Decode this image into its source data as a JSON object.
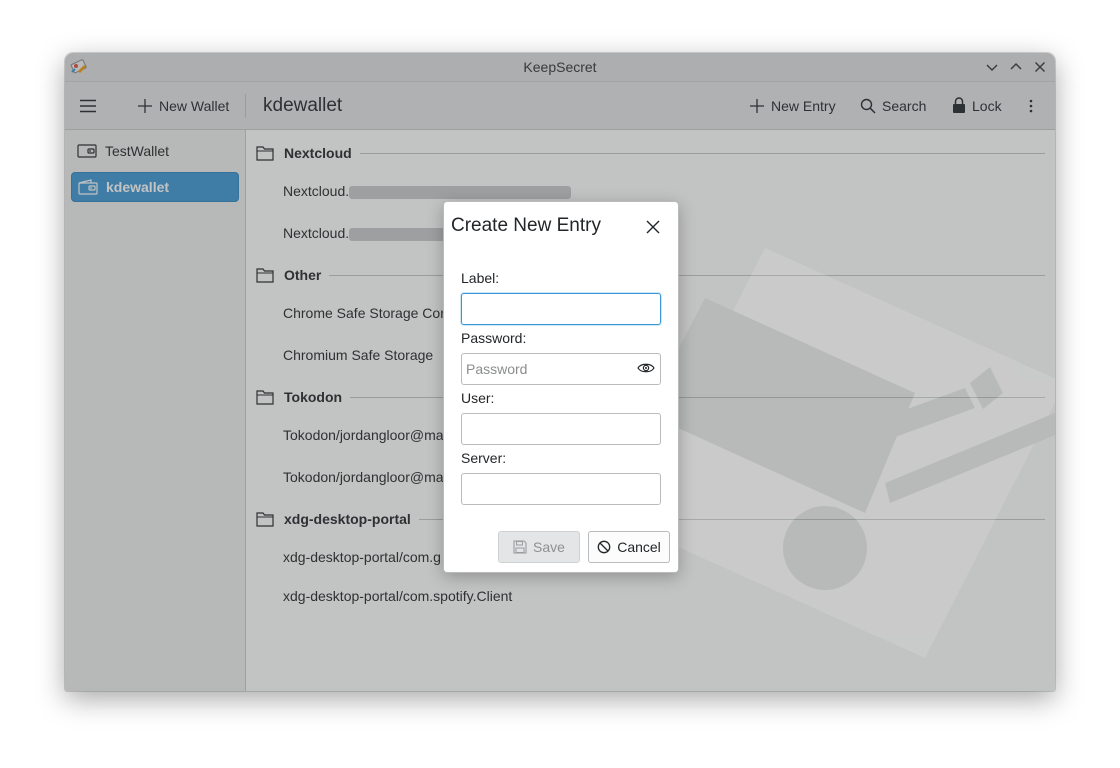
{
  "window": {
    "title": "KeepSecret"
  },
  "toolbar": {
    "new_wallet": "New Wallet",
    "page_title": "kdewallet",
    "new_entry": "New Entry",
    "search": "Search",
    "lock": "Lock"
  },
  "sidebar": {
    "items": [
      {
        "label": "TestWallet",
        "active": false
      },
      {
        "label": "kdewallet",
        "active": true
      }
    ]
  },
  "sections": [
    {
      "name": "Nextcloud",
      "entries": [
        "Nextcloud.",
        "Nextcloud."
      ]
    },
    {
      "name": "Other",
      "entries": [
        "Chrome Safe Storage Cont",
        "Chromium Safe Storage"
      ]
    },
    {
      "name": "Tokodon",
      "entries": [
        "Tokodon/jordangloor@ma",
        "Tokodon/jordangloor@ma"
      ]
    },
    {
      "name": "xdg-desktop-portal",
      "entries": [
        "xdg-desktop-portal/com.g",
        "xdg-desktop-portal/com.spotify.Client"
      ]
    }
  ],
  "dialog": {
    "title": "Create New Entry",
    "label_label": "Label:",
    "label_value": "",
    "password_label": "Password:",
    "password_placeholder": "Password",
    "user_label": "User:",
    "user_value": "",
    "server_label": "Server:",
    "server_value": "",
    "save": "Save",
    "cancel": "Cancel"
  },
  "colors": {
    "accent": "#3d97d6",
    "window_bg": "#eff0f1",
    "overlay": "#46484a"
  }
}
